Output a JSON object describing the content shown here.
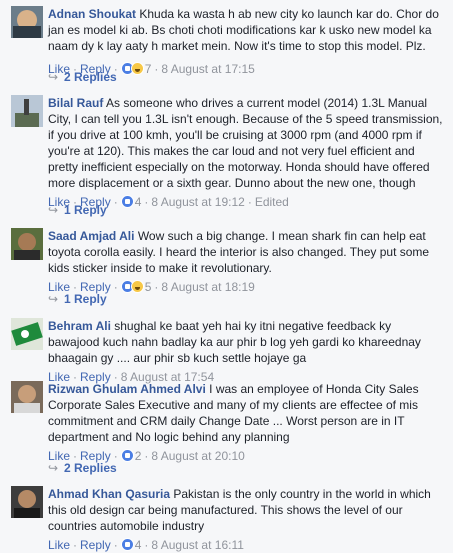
{
  "comments": [
    {
      "author": "Adnan Shoukat",
      "text": "Khuda ka wasta h ab new city ko launch kar do. Chor do jan es model ki ab. Bs choti choti modifications kar k usko new model ka naam dy k lay aaty h market mein. Now it's time to stop this model. Plz.",
      "like": "Like",
      "reply": "Reply",
      "reactions_count": "7",
      "timestamp": "8 August at 17:15",
      "edited": "",
      "replies": "2 Replies"
    },
    {
      "author": "Bilal Rauf",
      "text": "As someone who drives a current model (2014) 1.3L Manual City, I can tell you 1.3L isn't enough. Because of the 5 speed transmission, if you drive at 100 kmh, you'll be cruising at 3000 rpm (and 4000 rpm if you're at 120). This makes the car loud and not very fuel efficient and pretty inefficient especially on the motorway. Honda should have offered more displacement or a sixth gear. Dunno about the new one, though",
      "like": "Like",
      "reply": "Reply",
      "reactions_count": "4",
      "timestamp": "8 August at 19:12",
      "edited": "Edited",
      "replies": "1 Reply"
    },
    {
      "author": "Saad Amjad Ali",
      "text": "Wow such a big change. I mean shark fin can help eat toyota corolla easily. I heard the interior is also changed. They put some kids sticker inside to make it revolutionary.",
      "like": "Like",
      "reply": "Reply",
      "reactions_count": "5",
      "timestamp": "8 August at 18:19",
      "edited": "",
      "replies": "1 Reply"
    },
    {
      "author": "Behram Ali",
      "text": "shughal ke baat yeh hai ky itni negative feedback ky bawajood kuch nahn badlay ka aur phir b log yeh gardi ko khareednay bhaagain gy .... aur phir sb kuch settle hojaye ga",
      "like": "Like",
      "reply": "Reply",
      "reactions_count": "",
      "timestamp": "8 August at 17:54",
      "edited": "",
      "replies": ""
    },
    {
      "author": "Rizwan Ghulam Ahmed Alvi",
      "text": "I was an employee of Honda City Sales Corporate Sales Executive and many of my clients are effectee of mis commitment and CRM daily Change Date ... Worst person are in IT department and No logic behind any planning",
      "like": "Like",
      "reply": "Reply",
      "reactions_count": "2",
      "timestamp": "8 August at 20:10",
      "edited": "",
      "replies": "2 Replies"
    },
    {
      "author": "Ahmad Khan Qasuria",
      "text": "Pakistan is the only country in the world in which this old design car being manufactured. This shows the level of our countries automobile industry",
      "like": "Like",
      "reply": "Reply",
      "reactions_count": "4",
      "timestamp": "8 August at 16:11",
      "edited": "",
      "replies": ""
    }
  ],
  "icons": {
    "reply_arrow": "reply-arrow-icon",
    "like_reaction": "like-reaction-icon",
    "haha_reaction": "haha-reaction-icon"
  },
  "colors": {
    "author": "#365899",
    "link": "#4267b2",
    "meta": "#90949c",
    "background": "#f6f7f9"
  }
}
